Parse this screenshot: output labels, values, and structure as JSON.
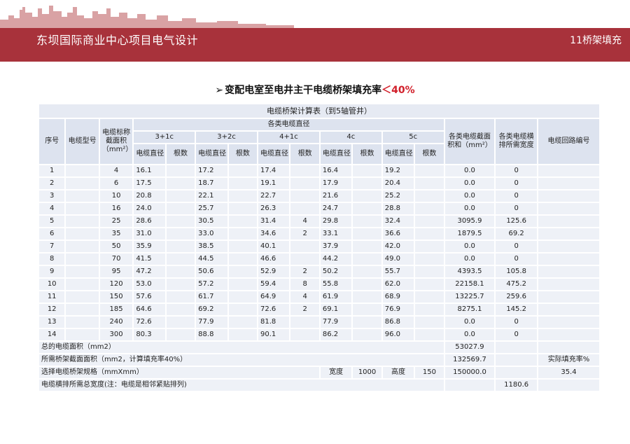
{
  "colors": {
    "banner": "#a8323b",
    "accent": "#d11f2a",
    "cell": "#eef1f7",
    "header": "#dde3ef"
  },
  "header": {
    "title": "东坝国际商业中心项目电气设计",
    "section": "11桥架填充"
  },
  "heading": {
    "arrow": "➢",
    "text": "变配电室至电井主干电缆桥架填充率",
    "accent": "＜40%"
  },
  "table": {
    "title": "电缆桥架计算表（到5轴管井）",
    "col_seq": "序号",
    "col_model": "电缆型号",
    "col_area": "电缆标称截面积（mm²）",
    "group_diam": "各类电缆直径",
    "groups": [
      "3+1c",
      "3+2c",
      "4+1c",
      "4c",
      "5c"
    ],
    "sub_diam": "电缆直径",
    "sub_count": "根数",
    "col_sum": "各类电缆截面积和（mm²）",
    "col_width": "各类电缆横排所需宽度",
    "col_circuit": "电缆回路编号",
    "rows": [
      {
        "seq": "1",
        "area": "4",
        "d1": "16.1",
        "d2": "17.2",
        "d3": "17.4",
        "n3": "",
        "d4": "16.4",
        "d5": "19.2",
        "sum": "0.0",
        "width": "0"
      },
      {
        "seq": "2",
        "area": "6",
        "d1": "17.5",
        "d2": "18.7",
        "d3": "19.1",
        "n3": "",
        "d4": "17.9",
        "d5": "20.4",
        "sum": "0.0",
        "width": "0"
      },
      {
        "seq": "3",
        "area": "10",
        "d1": "20.8",
        "d2": "22.1",
        "d3": "22.7",
        "n3": "",
        "d4": "21.6",
        "d5": "25.2",
        "sum": "0.0",
        "width": "0"
      },
      {
        "seq": "4",
        "area": "16",
        "d1": "24.0",
        "d2": "25.7",
        "d3": "26.3",
        "n3": "",
        "d4": "24.7",
        "d5": "28.8",
        "sum": "0.0",
        "width": "0"
      },
      {
        "seq": "5",
        "area": "25",
        "d1": "28.6",
        "d2": "30.5",
        "d3": "31.4",
        "n3": "4",
        "d4": "29.8",
        "d5": "32.4",
        "sum": "3095.9",
        "width": "125.6"
      },
      {
        "seq": "6",
        "area": "35",
        "d1": "31.0",
        "d2": "33.0",
        "d3": "34.6",
        "n3": "2",
        "d4": "33.1",
        "d5": "36.6",
        "sum": "1879.5",
        "width": "69.2"
      },
      {
        "seq": "7",
        "area": "50",
        "d1": "35.9",
        "d2": "38.5",
        "d3": "40.1",
        "n3": "",
        "d4": "37.9",
        "d5": "42.0",
        "sum": "0.0",
        "width": "0"
      },
      {
        "seq": "8",
        "area": "70",
        "d1": "41.5",
        "d2": "44.5",
        "d3": "46.6",
        "n3": "",
        "d4": "44.2",
        "d5": "49.0",
        "sum": "0.0",
        "width": "0"
      },
      {
        "seq": "9",
        "area": "95",
        "d1": "47.2",
        "d2": "50.6",
        "d3": "52.9",
        "n3": "2",
        "d4": "50.2",
        "d5": "55.7",
        "sum": "4393.5",
        "width": "105.8"
      },
      {
        "seq": "10",
        "area": "120",
        "d1": "53.0",
        "d2": "57.2",
        "d3": "59.4",
        "n3": "8",
        "d4": "55.8",
        "d5": "62.0",
        "sum": "22158.1",
        "width": "475.2"
      },
      {
        "seq": "11",
        "area": "150",
        "d1": "57.6",
        "d2": "61.7",
        "d3": "64.9",
        "n3": "4",
        "d4": "61.9",
        "d5": "68.9",
        "sum": "13225.7",
        "width": "259.6"
      },
      {
        "seq": "12",
        "area": "185",
        "d1": "64.6",
        "d2": "69.2",
        "d3": "72.6",
        "n3": "2",
        "d4": "69.1",
        "d5": "76.9",
        "sum": "8275.1",
        "width": "145.2"
      },
      {
        "seq": "13",
        "area": "240",
        "d1": "72.6",
        "d2": "77.9",
        "d3": "81.8",
        "n3": "",
        "d4": "77.9",
        "d5": "86.8",
        "sum": "0.0",
        "width": "0"
      },
      {
        "seq": "14",
        "area": "300",
        "d1": "80.3",
        "d2": "88.8",
        "d3": "90.1",
        "n3": "",
        "d4": "86.2",
        "d5": "96.0",
        "sum": "0.0",
        "width": "0"
      }
    ],
    "summary": {
      "total_label": "总的电缆面积（mm2）",
      "total_value": "53027.9",
      "required_label": "所需桥架截面面积（mm2，计算填充率40%）",
      "required_value": "132569.7",
      "actual_rate_label": "实际填充率%",
      "actual_rate_value": "35.4",
      "spec_label": "选择电缆桥架规格（mmXmm）",
      "width_label": "宽度",
      "width_value": "1000",
      "height_label": "高度",
      "height_value": "150",
      "spec_area": "150000.0",
      "total_width_label": "电缆横排所需总宽度(注：电缆是相邻紧贴排列)",
      "total_width_value": "1180.6"
    }
  }
}
